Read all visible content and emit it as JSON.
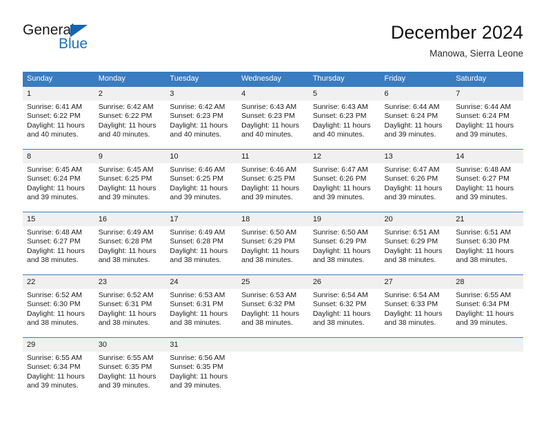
{
  "brand": {
    "name_part1": "General",
    "name_part2": "Blue",
    "logo_icon": "triangle-logo-icon",
    "accent_color": "#1266b0",
    "blue_text_color": "#1a72c0"
  },
  "header": {
    "title": "December 2024",
    "subtitle": "Manowa, Sierra Leone"
  },
  "calendar": {
    "header_bg": "#3a7cc0",
    "daynum_bg": "#f0f0f0",
    "weekdays": [
      "Sunday",
      "Monday",
      "Tuesday",
      "Wednesday",
      "Thursday",
      "Friday",
      "Saturday"
    ],
    "weeks": [
      [
        {
          "day": "1",
          "sunrise": "Sunrise: 6:41 AM",
          "sunset": "Sunset: 6:22 PM",
          "daylight1": "Daylight: 11 hours",
          "daylight2": "and 40 minutes."
        },
        {
          "day": "2",
          "sunrise": "Sunrise: 6:42 AM",
          "sunset": "Sunset: 6:22 PM",
          "daylight1": "Daylight: 11 hours",
          "daylight2": "and 40 minutes."
        },
        {
          "day": "3",
          "sunrise": "Sunrise: 6:42 AM",
          "sunset": "Sunset: 6:23 PM",
          "daylight1": "Daylight: 11 hours",
          "daylight2": "and 40 minutes."
        },
        {
          "day": "4",
          "sunrise": "Sunrise: 6:43 AM",
          "sunset": "Sunset: 6:23 PM",
          "daylight1": "Daylight: 11 hours",
          "daylight2": "and 40 minutes."
        },
        {
          "day": "5",
          "sunrise": "Sunrise: 6:43 AM",
          "sunset": "Sunset: 6:23 PM",
          "daylight1": "Daylight: 11 hours",
          "daylight2": "and 40 minutes."
        },
        {
          "day": "6",
          "sunrise": "Sunrise: 6:44 AM",
          "sunset": "Sunset: 6:24 PM",
          "daylight1": "Daylight: 11 hours",
          "daylight2": "and 39 minutes."
        },
        {
          "day": "7",
          "sunrise": "Sunrise: 6:44 AM",
          "sunset": "Sunset: 6:24 PM",
          "daylight1": "Daylight: 11 hours",
          "daylight2": "and 39 minutes."
        }
      ],
      [
        {
          "day": "8",
          "sunrise": "Sunrise: 6:45 AM",
          "sunset": "Sunset: 6:24 PM",
          "daylight1": "Daylight: 11 hours",
          "daylight2": "and 39 minutes."
        },
        {
          "day": "9",
          "sunrise": "Sunrise: 6:45 AM",
          "sunset": "Sunset: 6:25 PM",
          "daylight1": "Daylight: 11 hours",
          "daylight2": "and 39 minutes."
        },
        {
          "day": "10",
          "sunrise": "Sunrise: 6:46 AM",
          "sunset": "Sunset: 6:25 PM",
          "daylight1": "Daylight: 11 hours",
          "daylight2": "and 39 minutes."
        },
        {
          "day": "11",
          "sunrise": "Sunrise: 6:46 AM",
          "sunset": "Sunset: 6:25 PM",
          "daylight1": "Daylight: 11 hours",
          "daylight2": "and 39 minutes."
        },
        {
          "day": "12",
          "sunrise": "Sunrise: 6:47 AM",
          "sunset": "Sunset: 6:26 PM",
          "daylight1": "Daylight: 11 hours",
          "daylight2": "and 39 minutes."
        },
        {
          "day": "13",
          "sunrise": "Sunrise: 6:47 AM",
          "sunset": "Sunset: 6:26 PM",
          "daylight1": "Daylight: 11 hours",
          "daylight2": "and 39 minutes."
        },
        {
          "day": "14",
          "sunrise": "Sunrise: 6:48 AM",
          "sunset": "Sunset: 6:27 PM",
          "daylight1": "Daylight: 11 hours",
          "daylight2": "and 39 minutes."
        }
      ],
      [
        {
          "day": "15",
          "sunrise": "Sunrise: 6:48 AM",
          "sunset": "Sunset: 6:27 PM",
          "daylight1": "Daylight: 11 hours",
          "daylight2": "and 38 minutes."
        },
        {
          "day": "16",
          "sunrise": "Sunrise: 6:49 AM",
          "sunset": "Sunset: 6:28 PM",
          "daylight1": "Daylight: 11 hours",
          "daylight2": "and 38 minutes."
        },
        {
          "day": "17",
          "sunrise": "Sunrise: 6:49 AM",
          "sunset": "Sunset: 6:28 PM",
          "daylight1": "Daylight: 11 hours",
          "daylight2": "and 38 minutes."
        },
        {
          "day": "18",
          "sunrise": "Sunrise: 6:50 AM",
          "sunset": "Sunset: 6:29 PM",
          "daylight1": "Daylight: 11 hours",
          "daylight2": "and 38 minutes."
        },
        {
          "day": "19",
          "sunrise": "Sunrise: 6:50 AM",
          "sunset": "Sunset: 6:29 PM",
          "daylight1": "Daylight: 11 hours",
          "daylight2": "and 38 minutes."
        },
        {
          "day": "20",
          "sunrise": "Sunrise: 6:51 AM",
          "sunset": "Sunset: 6:29 PM",
          "daylight1": "Daylight: 11 hours",
          "daylight2": "and 38 minutes."
        },
        {
          "day": "21",
          "sunrise": "Sunrise: 6:51 AM",
          "sunset": "Sunset: 6:30 PM",
          "daylight1": "Daylight: 11 hours",
          "daylight2": "and 38 minutes."
        }
      ],
      [
        {
          "day": "22",
          "sunrise": "Sunrise: 6:52 AM",
          "sunset": "Sunset: 6:30 PM",
          "daylight1": "Daylight: 11 hours",
          "daylight2": "and 38 minutes."
        },
        {
          "day": "23",
          "sunrise": "Sunrise: 6:52 AM",
          "sunset": "Sunset: 6:31 PM",
          "daylight1": "Daylight: 11 hours",
          "daylight2": "and 38 minutes."
        },
        {
          "day": "24",
          "sunrise": "Sunrise: 6:53 AM",
          "sunset": "Sunset: 6:31 PM",
          "daylight1": "Daylight: 11 hours",
          "daylight2": "and 38 minutes."
        },
        {
          "day": "25",
          "sunrise": "Sunrise: 6:53 AM",
          "sunset": "Sunset: 6:32 PM",
          "daylight1": "Daylight: 11 hours",
          "daylight2": "and 38 minutes."
        },
        {
          "day": "26",
          "sunrise": "Sunrise: 6:54 AM",
          "sunset": "Sunset: 6:32 PM",
          "daylight1": "Daylight: 11 hours",
          "daylight2": "and 38 minutes."
        },
        {
          "day": "27",
          "sunrise": "Sunrise: 6:54 AM",
          "sunset": "Sunset: 6:33 PM",
          "daylight1": "Daylight: 11 hours",
          "daylight2": "and 38 minutes."
        },
        {
          "day": "28",
          "sunrise": "Sunrise: 6:55 AM",
          "sunset": "Sunset: 6:34 PM",
          "daylight1": "Daylight: 11 hours",
          "daylight2": "and 39 minutes."
        }
      ],
      [
        {
          "day": "29",
          "sunrise": "Sunrise: 6:55 AM",
          "sunset": "Sunset: 6:34 PM",
          "daylight1": "Daylight: 11 hours",
          "daylight2": "and 39 minutes."
        },
        {
          "day": "30",
          "sunrise": "Sunrise: 6:55 AM",
          "sunset": "Sunset: 6:35 PM",
          "daylight1": "Daylight: 11 hours",
          "daylight2": "and 39 minutes."
        },
        {
          "day": "31",
          "sunrise": "Sunrise: 6:56 AM",
          "sunset": "Sunset: 6:35 PM",
          "daylight1": "Daylight: 11 hours",
          "daylight2": "and 39 minutes."
        },
        {
          "day": "",
          "sunrise": "",
          "sunset": "",
          "daylight1": "",
          "daylight2": ""
        },
        {
          "day": "",
          "sunrise": "",
          "sunset": "",
          "daylight1": "",
          "daylight2": ""
        },
        {
          "day": "",
          "sunrise": "",
          "sunset": "",
          "daylight1": "",
          "daylight2": ""
        },
        {
          "day": "",
          "sunrise": "",
          "sunset": "",
          "daylight1": "",
          "daylight2": ""
        }
      ]
    ]
  }
}
